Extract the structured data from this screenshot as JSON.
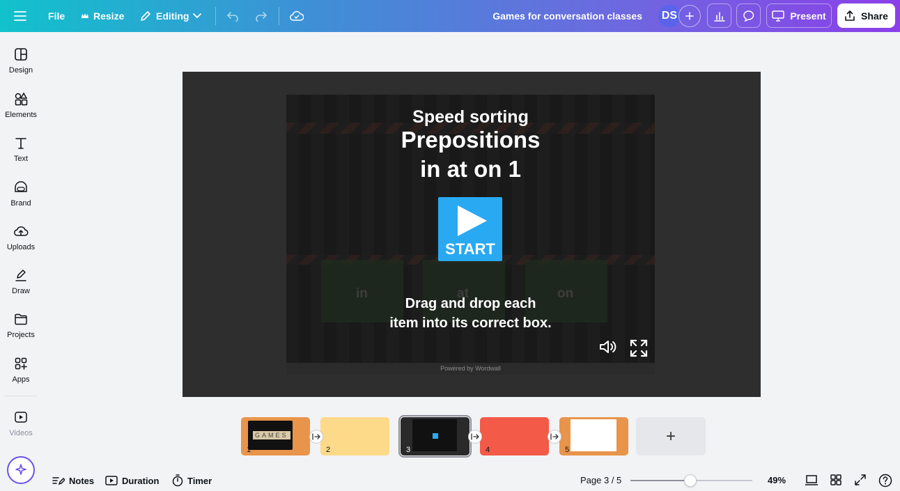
{
  "topbar": {
    "file_label": "File",
    "resize_label": "Resize",
    "editing_label": "Editing",
    "doc_title": "Games for conversation classes",
    "avatar_initials": "DS",
    "present_label": "Present",
    "share_label": "Share"
  },
  "sidebar": {
    "items": [
      {
        "label": "Design",
        "icon": "design-icon"
      },
      {
        "label": "Elements",
        "icon": "elements-icon"
      },
      {
        "label": "Text",
        "icon": "text-icon"
      },
      {
        "label": "Brand",
        "icon": "brand-icon"
      },
      {
        "label": "Uploads",
        "icon": "upload-icon"
      },
      {
        "label": "Draw",
        "icon": "draw-icon"
      },
      {
        "label": "Projects",
        "icon": "folder-icon"
      },
      {
        "label": "Apps",
        "icon": "apps-icon"
      },
      {
        "label": "Videos",
        "icon": "video-icon"
      }
    ]
  },
  "embed": {
    "title_line1": "Speed sorting",
    "title_line2": "Prepositions",
    "title_line3": "in at on 1",
    "start_label": "START",
    "instruction_line1": "Drag and drop each",
    "instruction_line2": "item into its correct box.",
    "footer": "Powered by Wordwall",
    "ghost_labels": [
      "in",
      "at",
      "on"
    ]
  },
  "thumbnails": [
    {
      "number": "1",
      "color": "#e8944a",
      "selected": false,
      "thumb_text": "GAMES"
    },
    {
      "number": "2",
      "color": "#fdd98a",
      "selected": false
    },
    {
      "number": "3",
      "color": "#2a2a2a",
      "selected": true
    },
    {
      "number": "4",
      "color": "#f35a48",
      "selected": false
    },
    {
      "number": "5",
      "color": "#e8944a",
      "selected": false
    }
  ],
  "add_page_label": "+",
  "bottombar": {
    "notes_label": "Notes",
    "duration_label": "Duration",
    "timer_label": "Timer",
    "page_indicator": "Page 3 / 5",
    "zoom_value": "49%",
    "zoom_fraction": 0.49
  },
  "colors": {
    "accent": "#8b3fe8",
    "topbar_start": "#11c2cc",
    "start_button": "#29a9f2"
  }
}
